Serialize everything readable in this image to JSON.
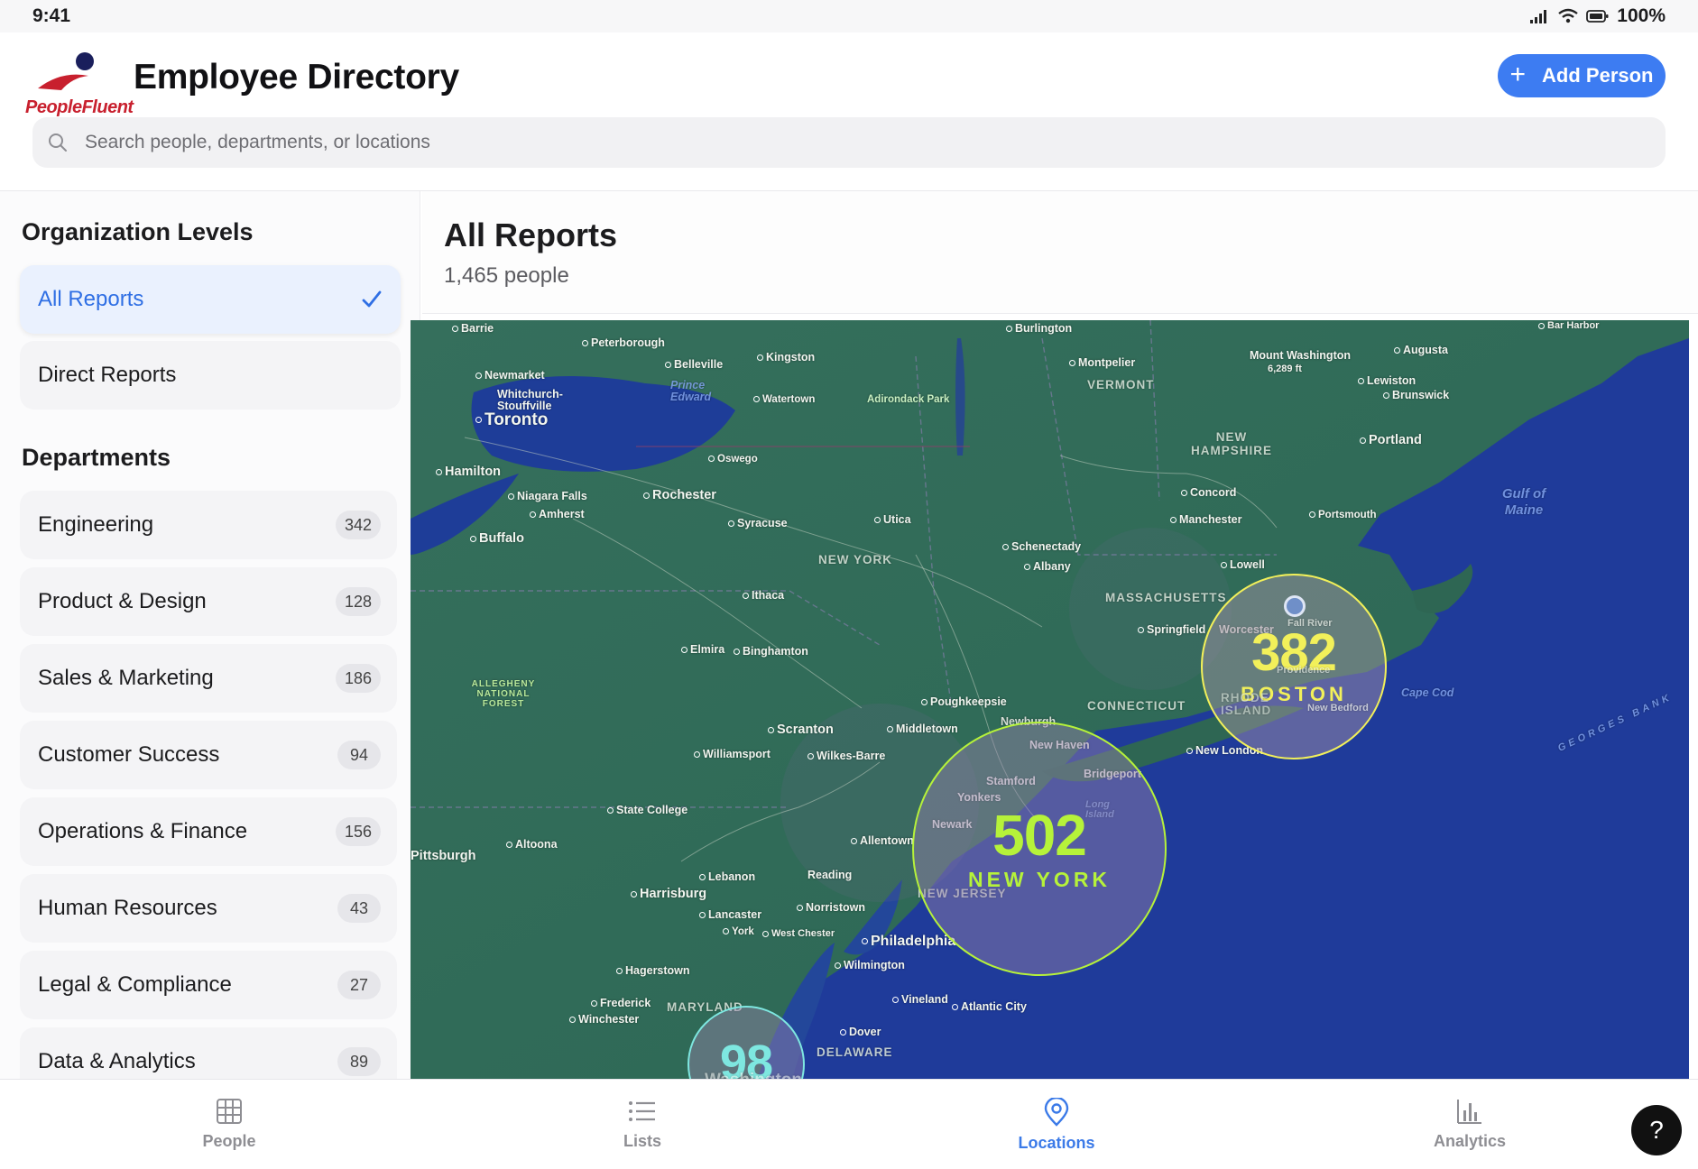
{
  "status_bar": {
    "time": "9:41",
    "battery": "100%"
  },
  "header": {
    "logo_text": "PeopleFluent",
    "title": "Employee Directory",
    "add_button_label": "Add Person",
    "search_placeholder": "Search people, departments, or locations"
  },
  "sidebar": {
    "org_title": "Organization Levels",
    "org_items": [
      {
        "label": "All Reports",
        "selected": true
      },
      {
        "label": "Direct Reports",
        "selected": false
      }
    ],
    "dept_title": "Departments",
    "departments": [
      {
        "label": "Engineering",
        "count": "342"
      },
      {
        "label": "Product & Design",
        "count": "128"
      },
      {
        "label": "Sales & Marketing",
        "count": "186"
      },
      {
        "label": "Customer Success",
        "count": "94"
      },
      {
        "label": "Operations & Finance",
        "count": "156"
      },
      {
        "label": "Human Resources",
        "count": "43"
      },
      {
        "label": "Legal & Compliance",
        "count": "27"
      },
      {
        "label": "Data & Analytics",
        "count": "89"
      }
    ]
  },
  "main": {
    "title": "All Reports",
    "subtitle": "1,465 people"
  },
  "map": {
    "clusters": [
      {
        "count": "382",
        "city": "BOSTON",
        "color": "#f2f05a"
      },
      {
        "count": "502",
        "city": "NEW YORK",
        "color": "#b6f23a"
      },
      {
        "count": "98",
        "city": "",
        "color": "#7ee7e0"
      }
    ],
    "labels": [
      "Barrie",
      "Peterborough",
      "Belleville",
      "Kingston",
      "Burlington",
      "Montpelier",
      "VERMONT",
      "Mount Washington",
      "6,289 ft",
      "Augusta",
      "Bar Harbor",
      "Lewiston",
      "Brunswick",
      "Portland",
      "Newmarket",
      "Whitchurch-Stouffville",
      "Toronto",
      "Prince Edward",
      "Watertown",
      "Adirondack Park",
      "NEW HAMPSHIRE",
      "Hamilton",
      "Oswego",
      "Niagara Falls",
      "Amherst",
      "Rochester",
      "Buffalo",
      "Syracuse",
      "Utica",
      "Concord",
      "Manchester",
      "Portsmouth",
      "Gulf of Maine",
      "Schenectady",
      "Albany",
      "NEW YORK",
      "Lowell",
      "Ithaca",
      "MASSACHUSETTS",
      "Worcester",
      "Springfield",
      "Elmira",
      "Binghamton",
      "ALLEGHENY NATIONAL FOREST",
      "Poughkeepsie",
      "CONNECTICUT",
      "Cape Cod",
      "Scranton",
      "Middletown",
      "Newburgh",
      "New Haven",
      "New London",
      "Williamsport",
      "Wilkes-Barre",
      "Bridgeport",
      "Stamford",
      "Yonkers",
      "Long Island",
      "State College",
      "Newark",
      "Allentown",
      "Altoona",
      "Pittsburgh",
      "NEW JERSEY",
      "Lebanon",
      "Reading",
      "Harrisburg",
      "Norristown",
      "Lancaster",
      "York",
      "West Chester",
      "Philadelphia",
      "Hagerstown",
      "Wilmington",
      "Frederick",
      "MARYLAND",
      "Winchester",
      "Vineland",
      "Atlantic City",
      "Dover",
      "DELAWARE",
      "GEORGES BANK",
      "Fall River",
      "New Bedford",
      "RHODE ISLAND",
      "Providence",
      "Washington"
    ]
  },
  "tabbar": {
    "tabs": [
      {
        "label": "People",
        "icon": "grid-icon"
      },
      {
        "label": "Lists",
        "icon": "list-icon"
      },
      {
        "label": "Locations",
        "icon": "map-pin-icon",
        "active": true
      },
      {
        "label": "Analytics",
        "icon": "bar-chart-icon"
      }
    ],
    "help_label": "?"
  },
  "colors": {
    "accent": "#3d7cf2",
    "brand_red": "#c8202e",
    "brand_navy": "#1a1f5c",
    "map_land": "#2f6b5a",
    "map_water": "#1f3b9a"
  }
}
